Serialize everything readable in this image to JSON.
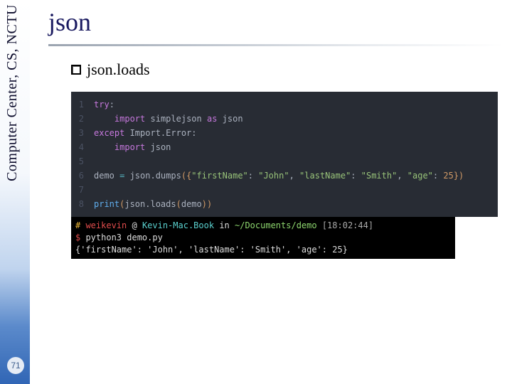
{
  "sidebar": {
    "org_text": "Computer Center, CS, NCTU"
  },
  "page_number": "71",
  "title": "json",
  "bullet": "json.loads",
  "code": {
    "lines": [
      {
        "n": "1",
        "tokens": [
          [
            "kw-pink",
            "try"
          ],
          [
            "kw-white",
            ":"
          ]
        ]
      },
      {
        "n": "2",
        "tokens": [
          [
            "kw-white",
            "    "
          ],
          [
            "kw-pink",
            "import"
          ],
          [
            "kw-white",
            " simplejson "
          ],
          [
            "kw-pink",
            "as"
          ],
          [
            "kw-white",
            " json"
          ]
        ]
      },
      {
        "n": "3",
        "tokens": [
          [
            "kw-pink",
            "except"
          ],
          [
            "kw-white",
            " Import.Error:"
          ]
        ]
      },
      {
        "n": "4",
        "tokens": [
          [
            "kw-white",
            "    "
          ],
          [
            "kw-pink",
            "import"
          ],
          [
            "kw-white",
            " json"
          ]
        ]
      },
      {
        "n": "5",
        "tokens": [
          [
            "kw-white",
            ""
          ]
        ]
      },
      {
        "n": "6",
        "tokens": [
          [
            "kw-white",
            "demo "
          ],
          [
            "kw-teal",
            "="
          ],
          [
            "kw-white",
            " json.dumps"
          ],
          [
            "kw-brace",
            "({"
          ],
          [
            "kw-green",
            "\"firstName\""
          ],
          [
            "kw-white",
            ": "
          ],
          [
            "kw-green",
            "\"John\""
          ],
          [
            "kw-white",
            ", "
          ],
          [
            "kw-green",
            "\"lastName\""
          ],
          [
            "kw-white",
            ": "
          ],
          [
            "kw-green",
            "\"Smith\""
          ],
          [
            "kw-white",
            ", "
          ],
          [
            "kw-green",
            "\"age\""
          ],
          [
            "kw-white",
            ": "
          ],
          [
            "kw-gold",
            "25"
          ],
          [
            "kw-brace",
            "})"
          ]
        ]
      },
      {
        "n": "7",
        "tokens": [
          [
            "kw-white",
            ""
          ]
        ]
      },
      {
        "n": "8",
        "tokens": [
          [
            "kw-blue",
            "print"
          ],
          [
            "kw-brace",
            "("
          ],
          [
            "kw-white",
            "json.loads"
          ],
          [
            "kw-gold",
            "("
          ],
          [
            "kw-white",
            "demo"
          ],
          [
            "kw-gold",
            ")"
          ],
          [
            "kw-brace",
            ")"
          ]
        ]
      }
    ]
  },
  "terminal": {
    "lines": [
      [
        [
          "t-hash",
          "# "
        ],
        [
          "t-red",
          "weikevin"
        ],
        [
          "t-white",
          " @ "
        ],
        [
          "t-cyan",
          "Kevin-Mac.Book"
        ],
        [
          "t-white",
          " in "
        ],
        [
          "t-user",
          "~/Documents/demo"
        ],
        [
          "t-gray",
          " [18:02:44]"
        ]
      ],
      [
        [
          "t-red",
          "$ "
        ],
        [
          "t-white",
          "python3 demo.py"
        ]
      ],
      [
        [
          "t-white",
          "{'firstName': 'John', 'lastName': 'Smith', 'age': 25}"
        ]
      ]
    ]
  }
}
